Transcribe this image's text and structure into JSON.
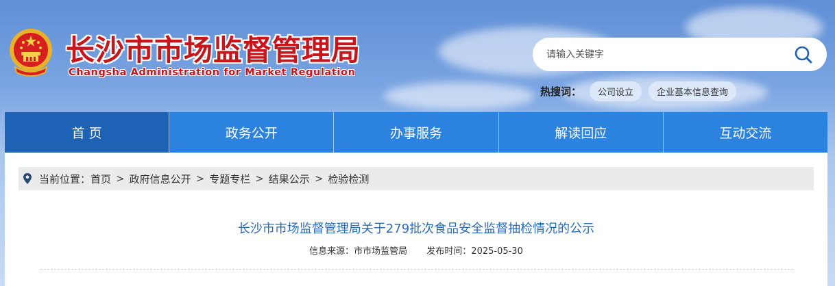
{
  "header": {
    "title": "长沙市市场监督管理局",
    "subtitle": "Changsha Administration for Market Regulation"
  },
  "search": {
    "placeholder": "请输入关键字",
    "hot_label": "热搜词：",
    "hot_terms": [
      "公司设立",
      "企业基本信息查询"
    ]
  },
  "nav": {
    "items": [
      "首 页",
      "政务公开",
      "办事服务",
      "解读回应",
      "互动交流"
    ],
    "active_index": 0
  },
  "breadcrumb": {
    "prefix": "当前位置：",
    "items": [
      "首页",
      "政府信息公开",
      "专题专栏",
      "结果公示",
      "检验检测"
    ],
    "separator": ">"
  },
  "article": {
    "title": "长沙市市场监督管理局关于279批次食品安全监督抽检情况的公示",
    "source": "信息来源：市市场监管局",
    "date": "发布时间：2025-05-30"
  },
  "colors": {
    "brand_red": "#c8151b",
    "nav_blue": "#2c82df",
    "nav_active": "#1d62b4",
    "title_blue": "#2a6bb8"
  }
}
